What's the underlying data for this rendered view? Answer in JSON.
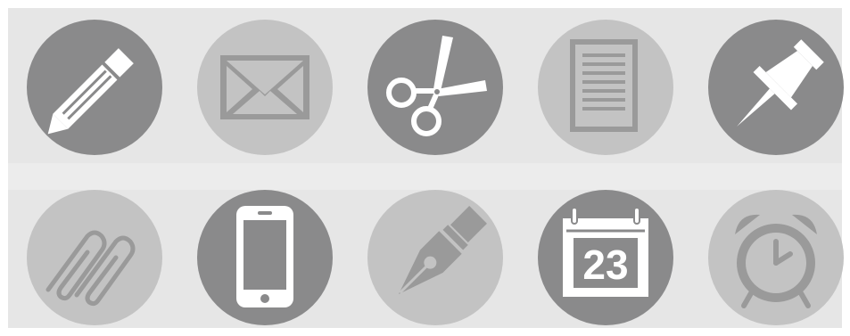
{
  "colors": {
    "panel_background": "#e6e6e6",
    "dark_circle": "#8a8a8b",
    "light_circle": "#c3c3c3",
    "glyph_white": "#ffffff",
    "glyph_gray": "#9a9a9a"
  },
  "icons_row_1": [
    {
      "name": "pencil-icon",
      "style": "dark"
    },
    {
      "name": "envelope-icon",
      "style": "light"
    },
    {
      "name": "scissors-icon",
      "style": "dark"
    },
    {
      "name": "document-icon",
      "style": "light"
    },
    {
      "name": "pushpin-icon",
      "style": "dark"
    }
  ],
  "icons_row_2": [
    {
      "name": "paperclips-icon",
      "style": "light"
    },
    {
      "name": "smartphone-icon",
      "style": "dark"
    },
    {
      "name": "fountain-pen-icon",
      "style": "light"
    },
    {
      "name": "calendar-icon",
      "style": "dark"
    },
    {
      "name": "alarm-clock-icon",
      "style": "light"
    }
  ],
  "calendar": {
    "day": "23"
  }
}
